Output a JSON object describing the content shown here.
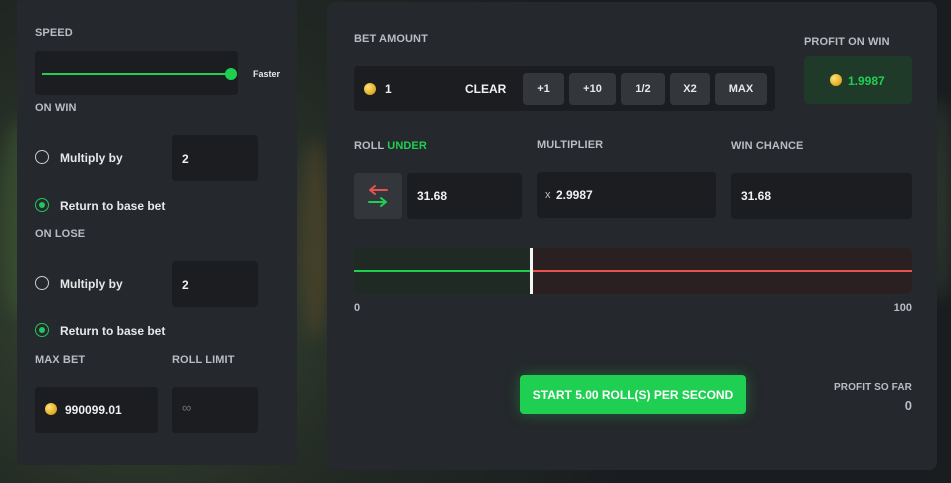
{
  "left": {
    "speed_label": "SPEED",
    "speed_level": 1.0,
    "speed_hint": "Faster",
    "on_win_label": "ON WIN",
    "on_win_multiply_label": "Multiply by",
    "on_win_multiply_value": "2",
    "on_win_return_label": "Return to base bet",
    "on_win_selected": "return",
    "on_lose_label": "ON LOSE",
    "on_lose_multiply_label": "Multiply by",
    "on_lose_multiply_value": "2",
    "on_lose_return_label": "Return to base bet",
    "on_lose_selected": "return",
    "max_bet_label": "MAX BET",
    "max_bet_value": "990099.01",
    "roll_limit_label": "ROLL LIMIT",
    "roll_limit_placeholder": "∞"
  },
  "right": {
    "bet_amount_label": "BET AMOUNT",
    "bet_amount_value": "1",
    "clear_label": "CLEAR",
    "quick_buttons": [
      "+1",
      "+10",
      "1/2",
      "X2",
      "MAX"
    ],
    "profit_on_win_label": "PROFIT ON WIN",
    "profit_on_win_value": "1.9987",
    "roll_label": "ROLL",
    "roll_mode": "UNDER",
    "roll_value": "31.68",
    "multiplier_label": "MULTIPLIER",
    "multiplier_prefix": "x",
    "multiplier_value": "2.9987",
    "win_chance_label": "WIN CHANCE",
    "win_chance_value": "31.68",
    "slider_min": "0",
    "slider_max": "100",
    "slider_value": 31.68,
    "start_button_label": "START 5.00 ROLL(S) PER SECOND",
    "profit_so_far_label": "PROFIT SO FAR",
    "profit_so_far_value": "0"
  },
  "colors": {
    "accent_green": "#1fcf52",
    "loss_red": "#e8524f",
    "panel": "#25282c",
    "field": "#1b1d20"
  },
  "icons": {
    "coin": "coin-icon",
    "swap": "swap-arrows-icon"
  }
}
